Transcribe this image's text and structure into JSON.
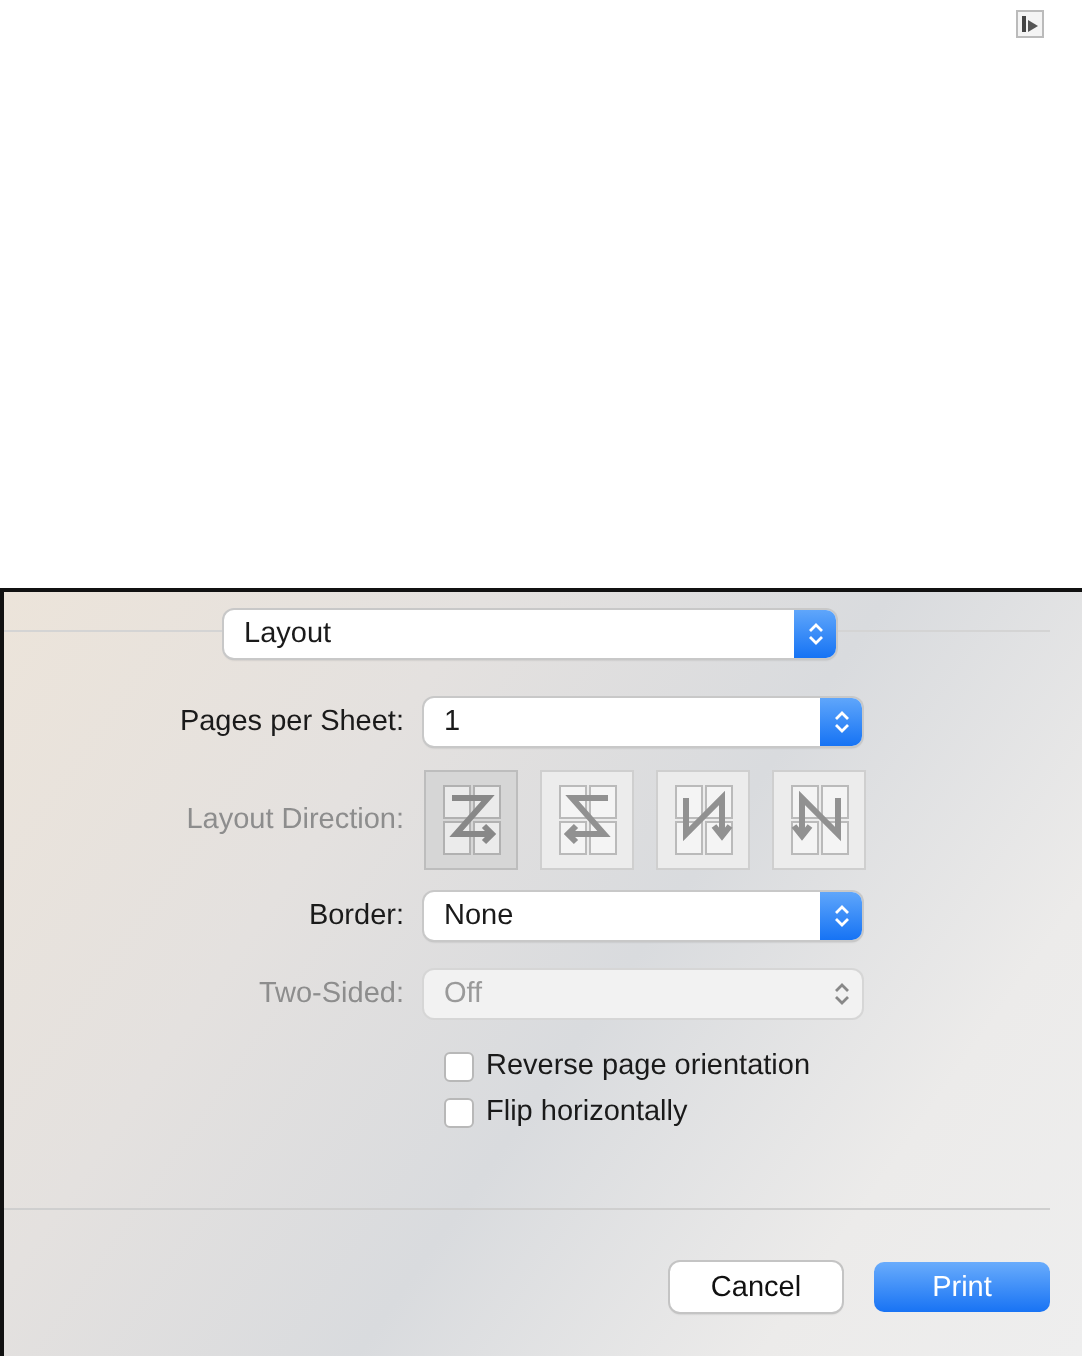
{
  "preset_menu": {
    "value": "Layout"
  },
  "pages_per_sheet": {
    "label": "Pages per Sheet:",
    "value": "1"
  },
  "layout_direction": {
    "label": "Layout Direction:",
    "disabled": true,
    "options": [
      {
        "kind": "z",
        "selected": true
      },
      {
        "kind": "reverse-z",
        "selected": false
      },
      {
        "kind": "reverse-n",
        "selected": false
      },
      {
        "kind": "n",
        "selected": false
      }
    ]
  },
  "border": {
    "label": "Border:",
    "value": "None"
  },
  "two_sided": {
    "label": "Two-Sided:",
    "value": "Off",
    "disabled": true
  },
  "checkboxes": [
    {
      "label": "Reverse page orientation",
      "checked": false
    },
    {
      "label": "Flip horizontally",
      "checked": false
    }
  ],
  "buttons": [
    {
      "label": "Cancel",
      "kind": "secondary"
    },
    {
      "label": "Print",
      "kind": "default"
    }
  ]
}
